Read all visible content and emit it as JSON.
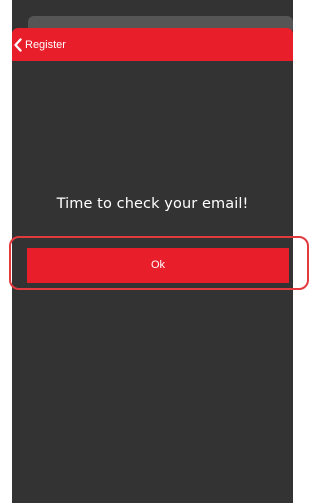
{
  "header": {
    "back_label": "Register",
    "back_icon": "chevron-left-icon",
    "color": "#e81e2a"
  },
  "main": {
    "message": "Time to check your email!",
    "ok_label": "Ok"
  },
  "colors": {
    "background": "#333333",
    "accent": "#e81e2a",
    "highlight_outline": "#e23a3f",
    "text": "#ffffff"
  }
}
